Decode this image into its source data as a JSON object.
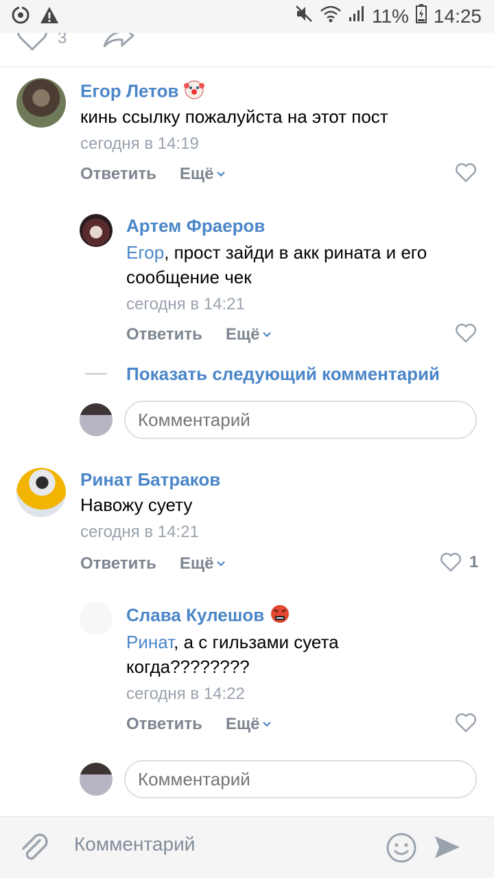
{
  "status_bar": {
    "battery": "11%",
    "time": "14:25"
  },
  "post": {
    "likes": "3"
  },
  "comments": [
    {
      "author": "Егор Летов",
      "text": "кинь ссылку пожалуйста на этот пост",
      "time": "сегодня в 14:19",
      "reply": "Ответить",
      "more": "Ещё",
      "likes": ""
    },
    {
      "author": "Артем Фраеров",
      "mention": "Егор",
      "text": ", прост зайди в акк рината и его сообщение чек",
      "time": "сегодня в 14:21",
      "reply": "Ответить",
      "more": "Ещё",
      "likes": ""
    },
    {
      "author": "Ринат Батраков",
      "text": "Навожу суету",
      "time": "сегодня в 14:21",
      "reply": "Ответить",
      "more": "Ещё",
      "likes": "1"
    },
    {
      "author": "Слава Кулешов",
      "mention": "Ринат",
      "text": ", а с гильзами суета когда????????",
      "time": "сегодня в 14:22",
      "reply": "Ответить",
      "more": "Ещё",
      "likes": ""
    }
  ],
  "show_next": "Показать следующий комментарий",
  "reply_input_placeholder": "Комментарий",
  "bottom_input_placeholder": "Комментарий",
  "colors": {
    "link": "#4a86c8",
    "secondary": "#99a2ad",
    "action": "#7d8590"
  }
}
